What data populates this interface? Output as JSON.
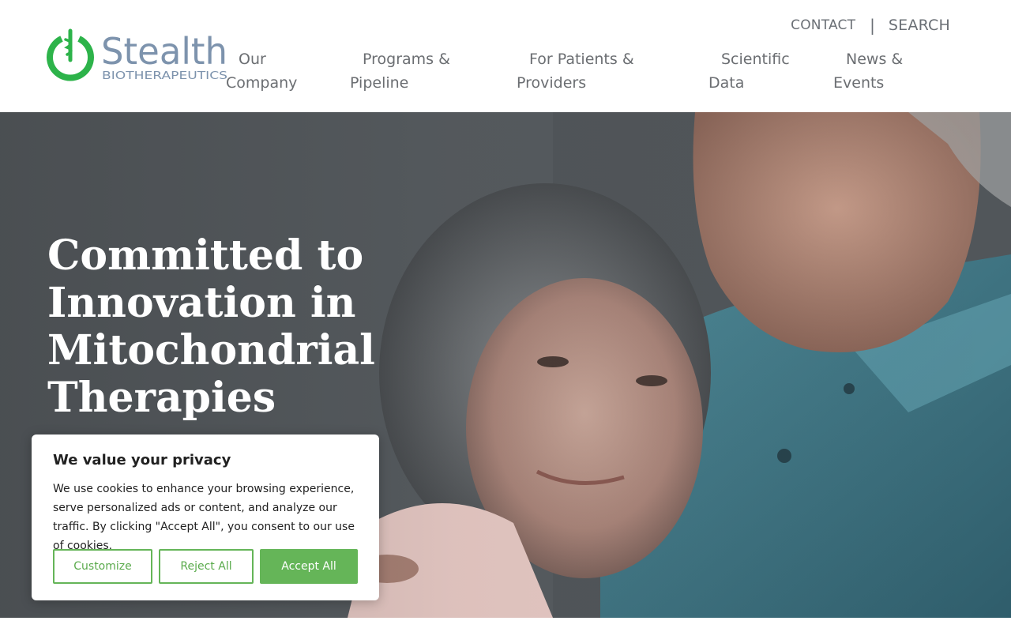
{
  "brand": {
    "name": "Stealth",
    "sub": "BIOTHERAPEUTICS",
    "primary_color": "#2db34a",
    "wordmark_color": "#7d93ad"
  },
  "utility": {
    "contact": "CONTACT",
    "separator": "|",
    "search": "SEARCH"
  },
  "nav": {
    "items": [
      {
        "line1": "Our",
        "line2": "Company"
      },
      {
        "line1": "Programs &",
        "line2": "Pipeline"
      },
      {
        "line1": "For Patients &",
        "line2": "Providers"
      },
      {
        "line1": "Scientific",
        "line2": "Data"
      },
      {
        "line1": "News &",
        "line2": "Events"
      }
    ]
  },
  "hero": {
    "title": "Committed to Innovation in Mitochondrial Therapies"
  },
  "cookie": {
    "title": "We value your privacy",
    "body": "We use cookies to enhance your browsing experience, serve personalized ads or content, and analyze our traffic. By clicking \"Accept All\", you consent to our use of cookies.",
    "customize": "Customize",
    "reject": "Reject All",
    "accept": "Accept All",
    "accent_color": "#65b558"
  }
}
